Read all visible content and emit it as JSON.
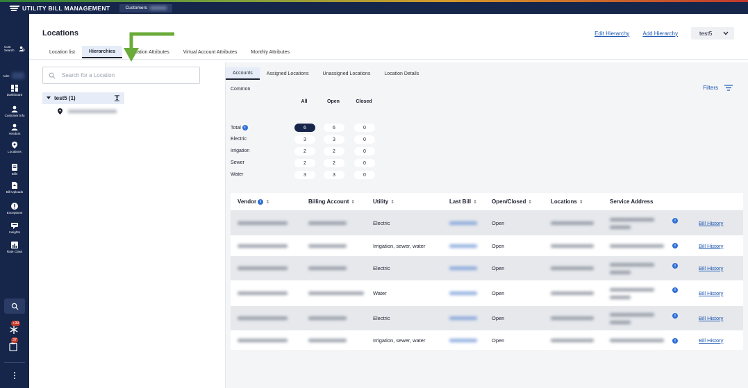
{
  "app": {
    "title": "UTILITY BILL MANAGEMENT",
    "customers_label": "Customers"
  },
  "nav": {
    "cust_search": "Cust Search",
    "adm": "Adm",
    "items": [
      {
        "label": "Dashboard",
        "icon": "dashboard-icon"
      },
      {
        "label": "Customer Info",
        "icon": "customer-icon"
      },
      {
        "label": "Vendors",
        "icon": "vendor-icon"
      },
      {
        "label": "Locations",
        "icon": "location-pin-icon"
      },
      {
        "label": "Bills",
        "icon": "bill-icon"
      },
      {
        "label": "Bill Uploads",
        "icon": "upload-icon"
      },
      {
        "label": "Exceptions",
        "icon": "exception-icon"
      },
      {
        "label": "Insights",
        "icon": "insights-icon"
      },
      {
        "label": "Rate Class",
        "icon": "rate-class-icon"
      }
    ],
    "badge_1": "+99",
    "badge_2": "37"
  },
  "header": {
    "page_title": "Locations",
    "edit_hierarchy": "Edit Hierarchy",
    "add_hierarchy": "Add Hierarchy",
    "user": "test5"
  },
  "tabs": [
    "Location list",
    "Hierarchies",
    "Location Attributes",
    "Virtual Account Attributes",
    "Monthly Attributes"
  ],
  "search": {
    "placeholder": "Search for a Location"
  },
  "tree": {
    "root": "test5 (1)"
  },
  "subtabs": [
    "Accounts",
    "Assigned Locations",
    "Unassigned Locations",
    "Location Details"
  ],
  "summary": {
    "section": "Common",
    "filters": "Filters",
    "columns": [
      "All",
      "Open",
      "Closed"
    ],
    "rows": [
      {
        "label": "Total",
        "values": [
          "6",
          "6",
          "0"
        ]
      },
      {
        "label": "Electric",
        "values": [
          "3",
          "3",
          "0"
        ]
      },
      {
        "label": "Irrigation",
        "values": [
          "2",
          "2",
          "0"
        ]
      },
      {
        "label": "Sewer",
        "values": [
          "2",
          "2",
          "0"
        ]
      },
      {
        "label": "Water",
        "values": [
          "3",
          "3",
          "0"
        ]
      }
    ]
  },
  "table": {
    "headers": [
      "Vendor",
      "Billing Account",
      "Utility",
      "Last Bill",
      "Open/Closed",
      "Locations",
      "Service Address"
    ],
    "rows": [
      {
        "utility": "Electric",
        "status": "Open",
        "history": "Bill History"
      },
      {
        "utility": "Irrigation, sewer, water",
        "status": "Open",
        "history": "Bill History"
      },
      {
        "utility": "Electric",
        "status": "Open",
        "history": "Bill History"
      },
      {
        "utility": "Water",
        "status": "Open",
        "history": "Bill History"
      },
      {
        "utility": "Electric",
        "status": "Open",
        "history": "Bill History"
      },
      {
        "utility": "Irrigation, sewer, water",
        "status": "Open",
        "history": "Bill History"
      }
    ]
  },
  "colors": {
    "nav_bg": "#16254a",
    "accent_arrow": "#6aab3a",
    "link": "#1a56b0"
  }
}
